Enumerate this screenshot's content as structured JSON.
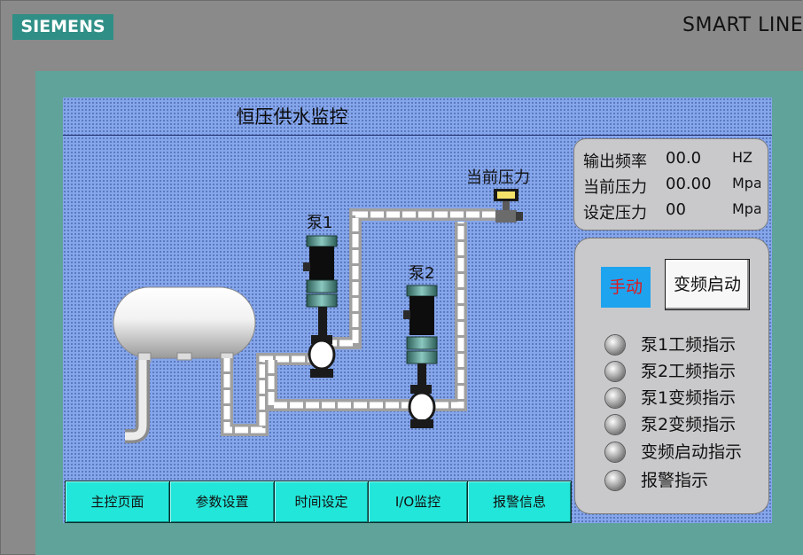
{
  "brand": {
    "logo_text": "SIEMENS",
    "title": "SMART LINE"
  },
  "screen": {
    "title": "恒压供水监控",
    "pressure_gauge_label": "当前压力",
    "pump1_label": "泵1",
    "pump2_label": "泵2"
  },
  "info": {
    "rows": [
      {
        "label": "输出频率",
        "value": "00.0",
        "unit": "HZ"
      },
      {
        "label": "当前压力",
        "value": "00.00",
        "unit": "Mpa"
      },
      {
        "label": "设定压力",
        "value": "00",
        "unit": "Mpa"
      }
    ]
  },
  "controls": {
    "manual_label": "手动",
    "vf_start_label": "变频启动"
  },
  "indicators": [
    {
      "label": "泵1工频指示"
    },
    {
      "label": "泵2工频指示"
    },
    {
      "label": "泵1变频指示"
    },
    {
      "label": "泵2变频指示"
    },
    {
      "label": "变频启动指示"
    },
    {
      "label": "报警指示"
    }
  ],
  "nav": [
    {
      "label": "主控页面"
    },
    {
      "label": "参数设置"
    },
    {
      "label": "时间设定"
    },
    {
      "label": "I/O监控"
    },
    {
      "label": "报警信息"
    }
  ],
  "colors": {
    "screen_bg": "#86a6ec",
    "bezel": "#5fa39a",
    "nav_button": "#22e6d9",
    "manual_button": "#1ea3ee",
    "manual_text": "#e0181e",
    "panel": "#c9c9cc"
  }
}
